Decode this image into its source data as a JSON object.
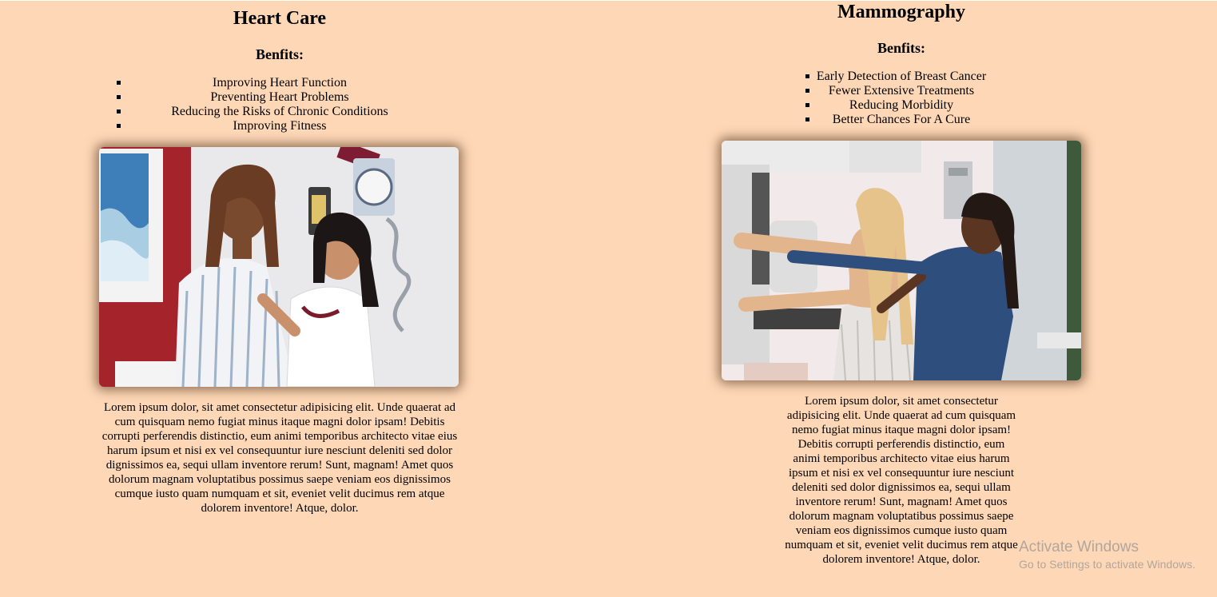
{
  "sections": [
    {
      "title": "Heart Care",
      "benefits_heading": "Benfits:",
      "benefits": [
        "Improving Heart Function",
        "Preventing Heart Problems",
        "Reducing the Risks of Chronic Conditions",
        "Improving Fitness"
      ],
      "image_alt": "doctor-checking-patient-heartbeat-photo",
      "description": "Lorem ipsum dolor, sit amet consectetur adipisicing elit. Unde quaerat ad cum quisquam nemo fugiat minus itaque magni dolor ipsam! Debitis corrupti perferendis distinctio, eum animi temporibus architecto vitae eius harum ipsum et nisi ex vel consequuntur iure nesciunt deleniti sed dolor dignissimos ea, sequi ullam inventore rerum! Sunt, magnam! Amet quos dolorum magnam voluptatibus possimus saepe veniam eos dignissimos cumque iusto quam numquam et sit, eveniet velit ducimus rem atque dolorem inventore! Atque, dolor."
    },
    {
      "title": "Mammography",
      "benefits_heading": "Benfits:",
      "benefits": [
        "Early Detection of Breast Cancer",
        "Fewer Extensive Treatments",
        "Reducing Morbidity",
        "Better Chances For A Cure"
      ],
      "image_alt": "mammography-exam-photo",
      "description": "Lorem ipsum dolor, sit amet consectetur adipisicing elit. Unde quaerat ad cum quisquam nemo fugiat minus itaque magni dolor ipsam! Debitis corrupti perferendis distinctio, eum animi temporibus architecto vitae eius harum ipsum et nisi ex vel consequuntur iure nesciunt deleniti sed dolor dignissimos ea, sequi ullam inventore rerum! Sunt, magnam! Amet quos dolorum magnam voluptatibus possimus saepe veniam eos dignissimos cumque iusto quam numquam et sit, eveniet velit ducimus rem atque dolorem inventore! Atque, dolor."
    }
  ],
  "watermark": {
    "title": "Activate Windows",
    "subtitle": "Go to Settings to activate Windows."
  },
  "colors": {
    "background": "#fed8b6",
    "text": "#000000"
  }
}
